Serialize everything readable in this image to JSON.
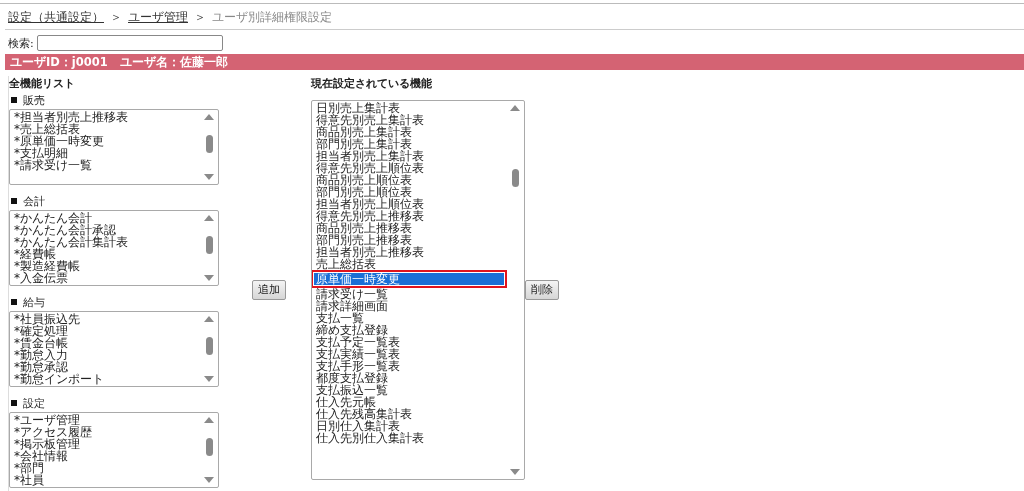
{
  "breadcrumb": [
    {
      "label": "設定（共通設定）",
      "link": true
    },
    {
      "label": "＞",
      "link": false
    },
    {
      "label": "ユーザ管理",
      "link": true
    },
    {
      "label": "＞",
      "link": false
    },
    {
      "label": "ユーザ別詳細権限設定",
      "link": false
    }
  ],
  "search": {
    "label": "検索:"
  },
  "user_bar": {
    "text": "ユーザID：j0001　ユーザ名：佐藤一郎"
  },
  "all_functions": {
    "title": "全機能リスト",
    "groups": [
      {
        "name": "販売",
        "items": [
          "*担当者別売上推移表",
          "*売上総括表",
          "*原単価一時変更",
          "*支払明細",
          "*請求受け一覧"
        ]
      },
      {
        "name": "会計",
        "items": [
          "*かんたん会計",
          "*かんたん会計承認",
          "*かんたん会計集計表",
          "*経費帳",
          "*製造経費帳",
          "*入金伝票"
        ]
      },
      {
        "name": "給与",
        "items": [
          "*社員振込先",
          "*確定処理",
          "*賃金台帳",
          "*勤怠入力",
          "*勤怠承認",
          "*勤怠インポート"
        ]
      },
      {
        "name": "設定",
        "items": [
          "*ユーザ管理",
          "*アクセス履歴",
          "*掲示板管理",
          "*会社情報",
          "*部門",
          "*社員"
        ]
      }
    ]
  },
  "add_button": "追加",
  "current_functions": {
    "title": "現在設定されている機能",
    "items": [
      {
        "label": "日別売上集計表",
        "selected": false
      },
      {
        "label": "得意先別売上集計表",
        "selected": false
      },
      {
        "label": "商品別売上集計表",
        "selected": false
      },
      {
        "label": "部門別売上集計表",
        "selected": false
      },
      {
        "label": "担当者別売上集計表",
        "selected": false
      },
      {
        "label": "得意先別売上順位表",
        "selected": false
      },
      {
        "label": "商品別売上順位表",
        "selected": false
      },
      {
        "label": "部門別売上順位表",
        "selected": false
      },
      {
        "label": "担当者別売上順位表",
        "selected": false
      },
      {
        "label": "得意先別売上推移表",
        "selected": false
      },
      {
        "label": "商品別売上推移表",
        "selected": false
      },
      {
        "label": "部門別売上推移表",
        "selected": false
      },
      {
        "label": "担当者別売上推移表",
        "selected": false
      },
      {
        "label": "売上総括表",
        "selected": false
      },
      {
        "label": "原単価一時変更",
        "selected": true
      },
      {
        "label": "請求受け一覧",
        "selected": false
      },
      {
        "label": "請求詳細画面",
        "selected": false
      },
      {
        "label": "支払一覧",
        "selected": false
      },
      {
        "label": "締め支払登録",
        "selected": false
      },
      {
        "label": "支払予定一覧表",
        "selected": false
      },
      {
        "label": "支払実績一覧表",
        "selected": false
      },
      {
        "label": "支払手形一覧表",
        "selected": false
      },
      {
        "label": "都度支払登録",
        "selected": false
      },
      {
        "label": "支払振込一覧",
        "selected": false
      },
      {
        "label": "仕入先元帳",
        "selected": false
      },
      {
        "label": "仕入先残高集計表",
        "selected": false
      },
      {
        "label": "日別仕入集計表",
        "selected": false
      },
      {
        "label": "仕入先別仕入集計表",
        "selected": false
      }
    ]
  },
  "delete_button": "削除"
}
